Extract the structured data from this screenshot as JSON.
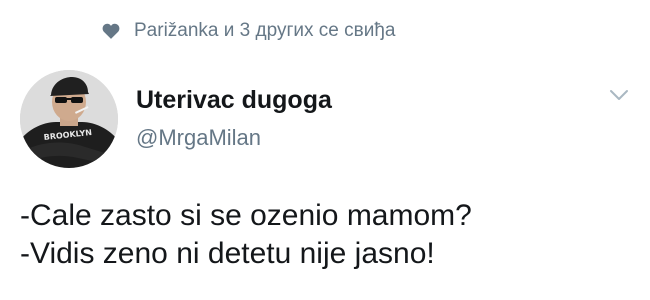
{
  "social_context": {
    "icon": "heart-icon",
    "text": "Parižanka и 3 других се свиђа"
  },
  "author": {
    "display_name": "Uterivac dugoga",
    "handle": "@MrgaMilan",
    "avatar_shirt_text": "BROOKLYN"
  },
  "menu": {
    "icon": "chevron-down-icon"
  },
  "tweet": {
    "lines": [
      "-Cale zasto si se ozenio mamom?",
      "-Vidis zeno ni detetu nije jasno!"
    ]
  },
  "colors": {
    "text_primary": "#14171a",
    "text_secondary": "#657786",
    "icon": "#657786",
    "chevron": "#aab8c2"
  }
}
